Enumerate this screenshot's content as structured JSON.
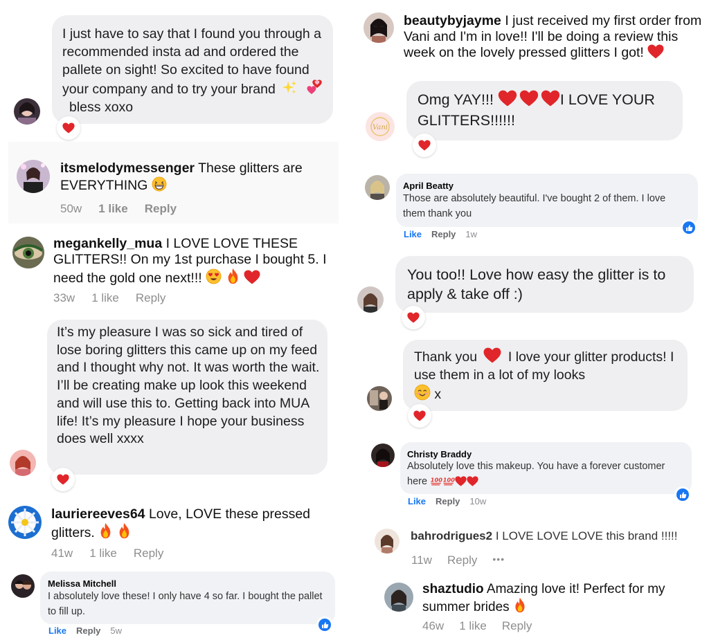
{
  "left": {
    "c1": {
      "text": "I just have to say that I found you through a recommended insta ad and ordered the pallete on sight! So excited to have found your company and to try your brand",
      "tail": "bless xoxo",
      "emoji": [
        "sparkles-emoji",
        "two-hearts-emoji"
      ]
    },
    "c2": {
      "username": "itsmelodymessenger",
      "text": "These glitters are EVERYTHING",
      "time": "50w",
      "likes": "1 like",
      "reply": "Reply"
    },
    "c3": {
      "username": "megankelly_mua",
      "text": "I LOVE LOVE THESE GLITTERS!! On my 1st purchase I bought 5.  I need the gold one next!!!",
      "time": "33w",
      "likes": "1 like",
      "reply": "Reply"
    },
    "c4": {
      "text": "It’s my pleasure I was so sick and tired of lose boring glitters this came up on my feed and I thought why not. It was worth the wait. I’ll be creating make up look this weekend and will use this to. Getting back into MUA life! It’s my pleasure I hope your business does well xxxx"
    },
    "c5": {
      "username": "lauriereeves64",
      "text": "Love, LOVE these pressed glitters.",
      "time": "41w",
      "likes": "1 like",
      "reply": "Reply"
    },
    "c6": {
      "name": "Melissa Mitchell",
      "text": "I absolutely love these! I only have 4 so far. I bought the pallet to fill up.",
      "like": "Like",
      "reply": "Reply",
      "time": "5w"
    }
  },
  "right": {
    "c1": {
      "username": "beautybyjayme",
      "text": "I just received my first order from Vani and I'm in love!! I'll be doing a review this week on the lovely pressed glitters I got!"
    },
    "c2": {
      "pre": "Omg YAY!!!",
      "post": "I LOVE YOUR",
      "line2": "GLITTERS!!!!!!"
    },
    "c3": {
      "name": "April Beatty",
      "text": "Those are absolutely beautiful. I've bought 2 of them. I love them thank you",
      "like": "Like",
      "reply": "Reply",
      "time": "1w"
    },
    "c4": {
      "text": "You too!! Love how easy the glitter is to apply & take off :)"
    },
    "c5": {
      "pre": "Thank you",
      "post": "I love your glitter products! I use them in a lot of my looks",
      "tail": "x"
    },
    "c6": {
      "name": "Christy Braddy",
      "text": "Absolutely love this makeup. You have a forever customer here",
      "like": "Like",
      "reply": "Reply",
      "time": "10w"
    },
    "c7": {
      "username": "bahrodrigues2",
      "text": "I LOVE LOVE LOVE this brand !!!!!",
      "time": "11w",
      "reply": "Reply",
      "more": "•••"
    },
    "c8": {
      "username": "shaztudio",
      "text": "Amazing love it! Perfect for my summer brides",
      "time": "46w",
      "likes": "1 like",
      "reply": "Reply"
    }
  },
  "colors": {
    "heart": "#e0262a",
    "fb_blue": "#1877f2",
    "bubble": "#efeff1",
    "meta": "#8e8e8e"
  }
}
